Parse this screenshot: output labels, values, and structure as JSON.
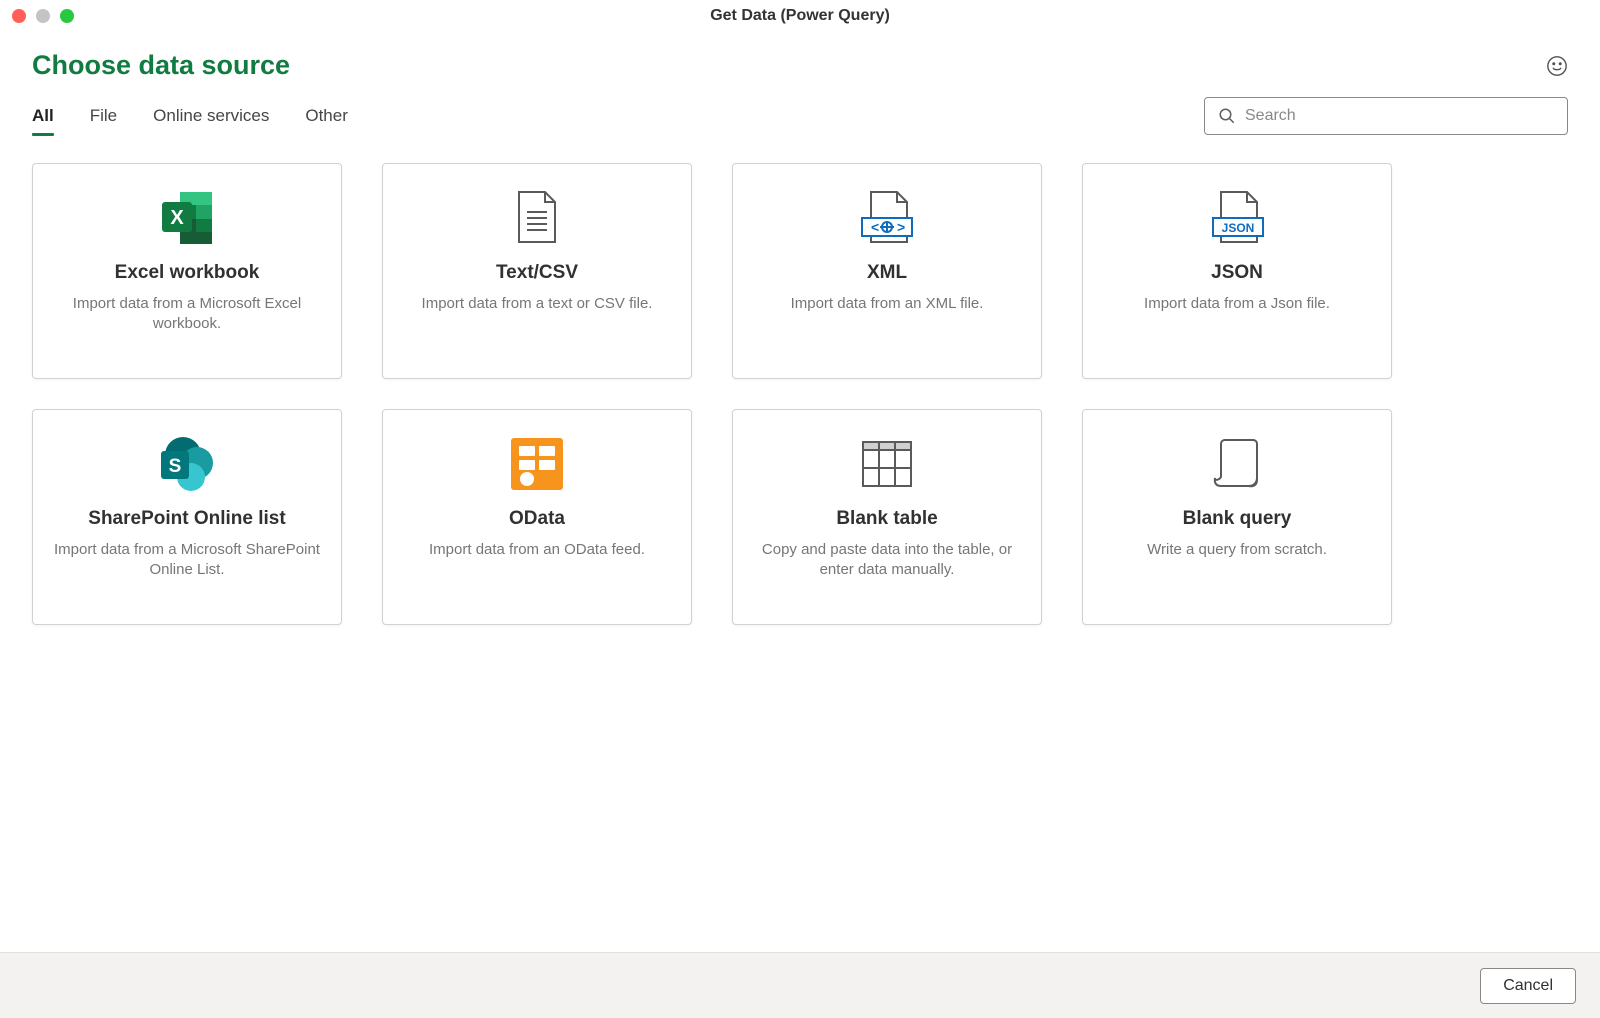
{
  "window": {
    "title": "Get Data (Power Query)"
  },
  "page": {
    "title": "Choose data source"
  },
  "tabs": [
    {
      "id": "all",
      "label": "All",
      "active": true
    },
    {
      "id": "file",
      "label": "File",
      "active": false
    },
    {
      "id": "online",
      "label": "Online services",
      "active": false
    },
    {
      "id": "other",
      "label": "Other",
      "active": false
    }
  ],
  "search": {
    "placeholder": "Search",
    "value": ""
  },
  "sources": [
    {
      "id": "excel",
      "title": "Excel workbook",
      "desc": "Import data from a Microsoft Excel workbook."
    },
    {
      "id": "textcsv",
      "title": "Text/CSV",
      "desc": "Import data from a text or CSV file."
    },
    {
      "id": "xml",
      "title": "XML",
      "desc": "Import data from an XML file."
    },
    {
      "id": "json",
      "title": "JSON",
      "desc": "Import data from a Json file."
    },
    {
      "id": "sharepoint",
      "title": "SharePoint Online list",
      "desc": "Import data from a Microsoft SharePoint Online List."
    },
    {
      "id": "odata",
      "title": "OData",
      "desc": "Import data from an OData feed."
    },
    {
      "id": "blanktable",
      "title": "Blank table",
      "desc": "Copy and paste data into the table, or enter data manually."
    },
    {
      "id": "blankquery",
      "title": "Blank query",
      "desc": "Write a query from scratch."
    }
  ],
  "footer": {
    "cancel": "Cancel"
  }
}
